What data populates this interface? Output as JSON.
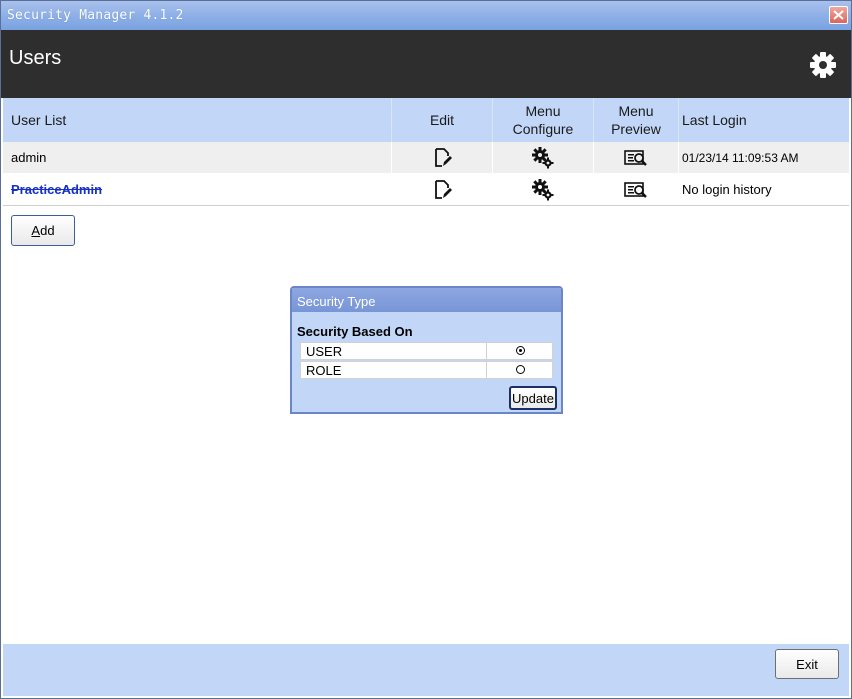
{
  "window": {
    "title": "Security Manager 4.1.2"
  },
  "header": {
    "title": "Users"
  },
  "grid": {
    "columns": {
      "user_list": "User List",
      "edit": "Edit",
      "menu_configure": "Menu\nConfigure",
      "menu_preview": "Menu\nPreview",
      "last_login": "Last Login"
    },
    "rows": [
      {
        "user": "admin",
        "last_login": "01/23/14 11:09:53 AM"
      },
      {
        "user": "PracticeAdmin",
        "last_login": "No login history"
      }
    ]
  },
  "add_button": {
    "accel": "A",
    "rest": "dd"
  },
  "dialog": {
    "title": "Security Type",
    "label": "Security Based On",
    "options": [
      {
        "label": "USER",
        "checked": true
      },
      {
        "label": "ROLE",
        "checked": false
      }
    ],
    "update_label": "Update"
  },
  "footer": {
    "exit_label": "Exit"
  },
  "icons": {
    "settings": "gear-icon",
    "edit": "edit-document-icon",
    "configure": "gears-icon",
    "preview": "preview-icon",
    "close": "close-icon"
  },
  "colors": {
    "header_bg": "#2e2e2e",
    "grid_header_bg": "#c2d7f7",
    "strike_user": "#1630c8",
    "titlebar": "#8caee6"
  }
}
